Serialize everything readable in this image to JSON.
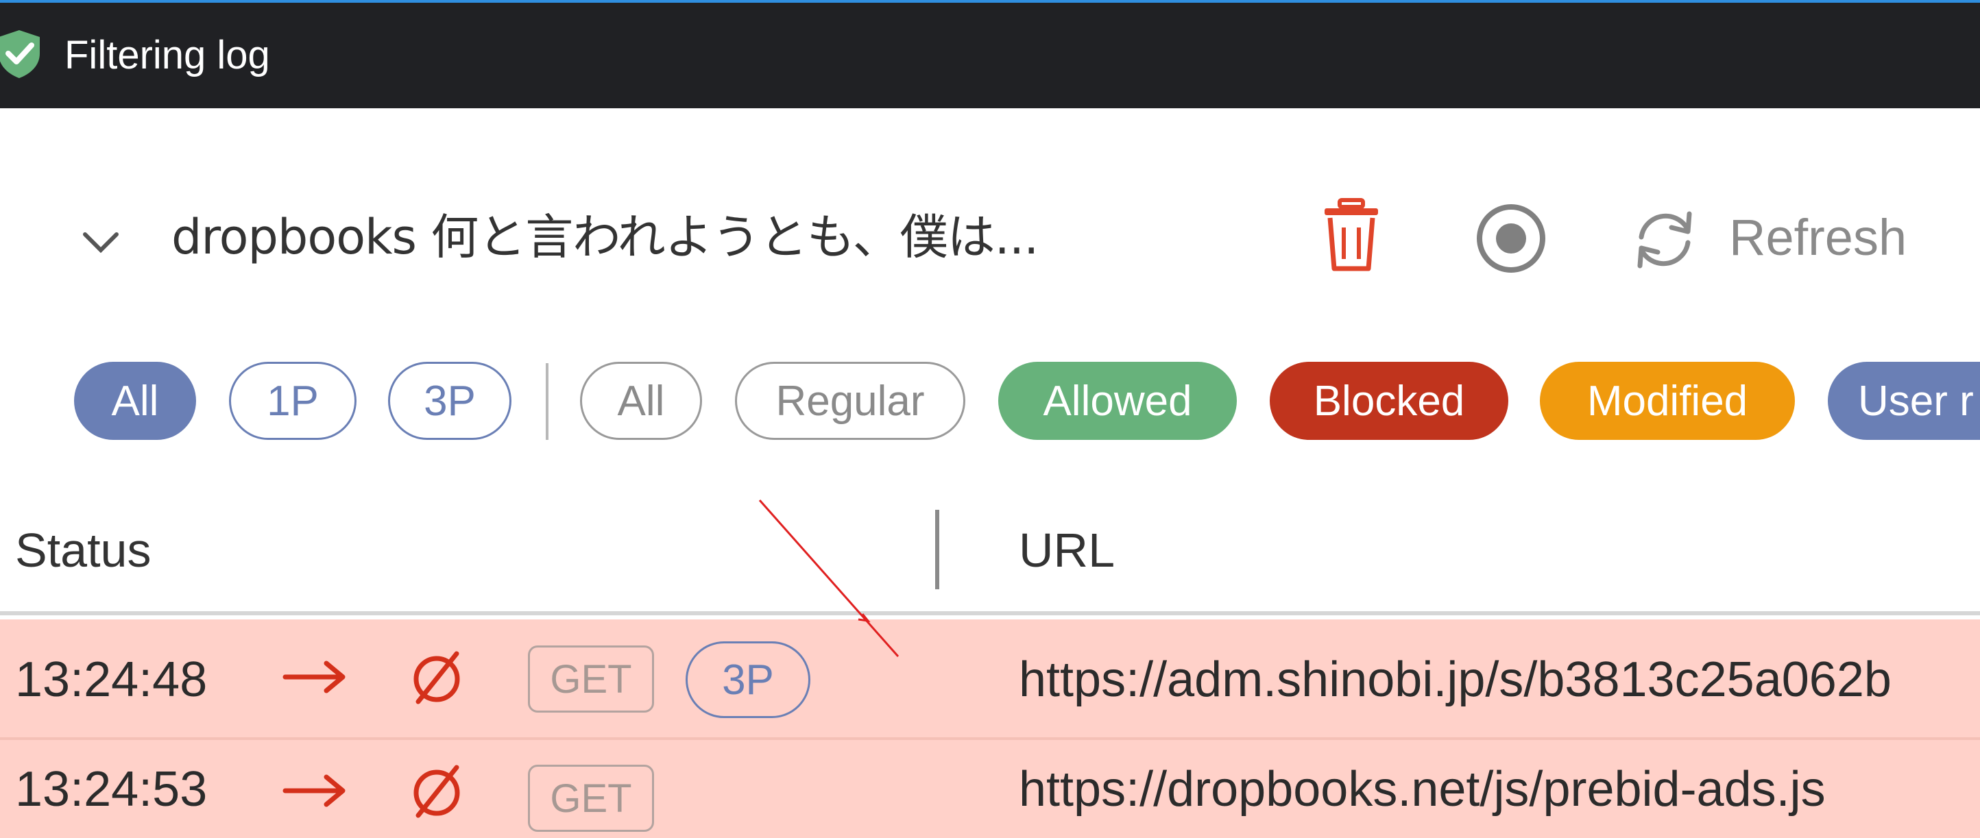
{
  "window": {
    "title": "Filtering log"
  },
  "toolbar": {
    "page_select": "dropbooks 何と言われようとも、僕は...",
    "refresh_label": "Refresh"
  },
  "filters": {
    "party": [
      "All",
      "1P",
      "3P"
    ],
    "type": [
      "All",
      "Regular",
      "Allowed",
      "Blocked",
      "Modified",
      "User r"
    ]
  },
  "table": {
    "columns": [
      "Status",
      "URL"
    ],
    "rows": [
      {
        "time": "13:24:48",
        "method": "GET",
        "party": "3P",
        "url": "https://adm.shinobi.jp/s/b3813c25a062b"
      },
      {
        "time": "13:24:53",
        "method": "GET",
        "party": "",
        "url": "https://dropbooks.net/js/prebid-ads.js"
      }
    ]
  },
  "colors": {
    "titlebar": "#202124",
    "accent": "#2f8fe0",
    "filter_blue": "#6a7fb5",
    "allowed": "#67b27b",
    "blocked": "#c0341d",
    "modified": "#f09a0e",
    "blocked_row": "#ffd1c9",
    "trash": "#e0452a"
  },
  "icons": {
    "app": "shield-check-icon",
    "page_select": "chevron-down-icon",
    "clear": "trash-icon",
    "record": "record-icon",
    "refresh": "refresh-icon",
    "direction": "arrow-right-icon",
    "status": "blocked-icon"
  }
}
